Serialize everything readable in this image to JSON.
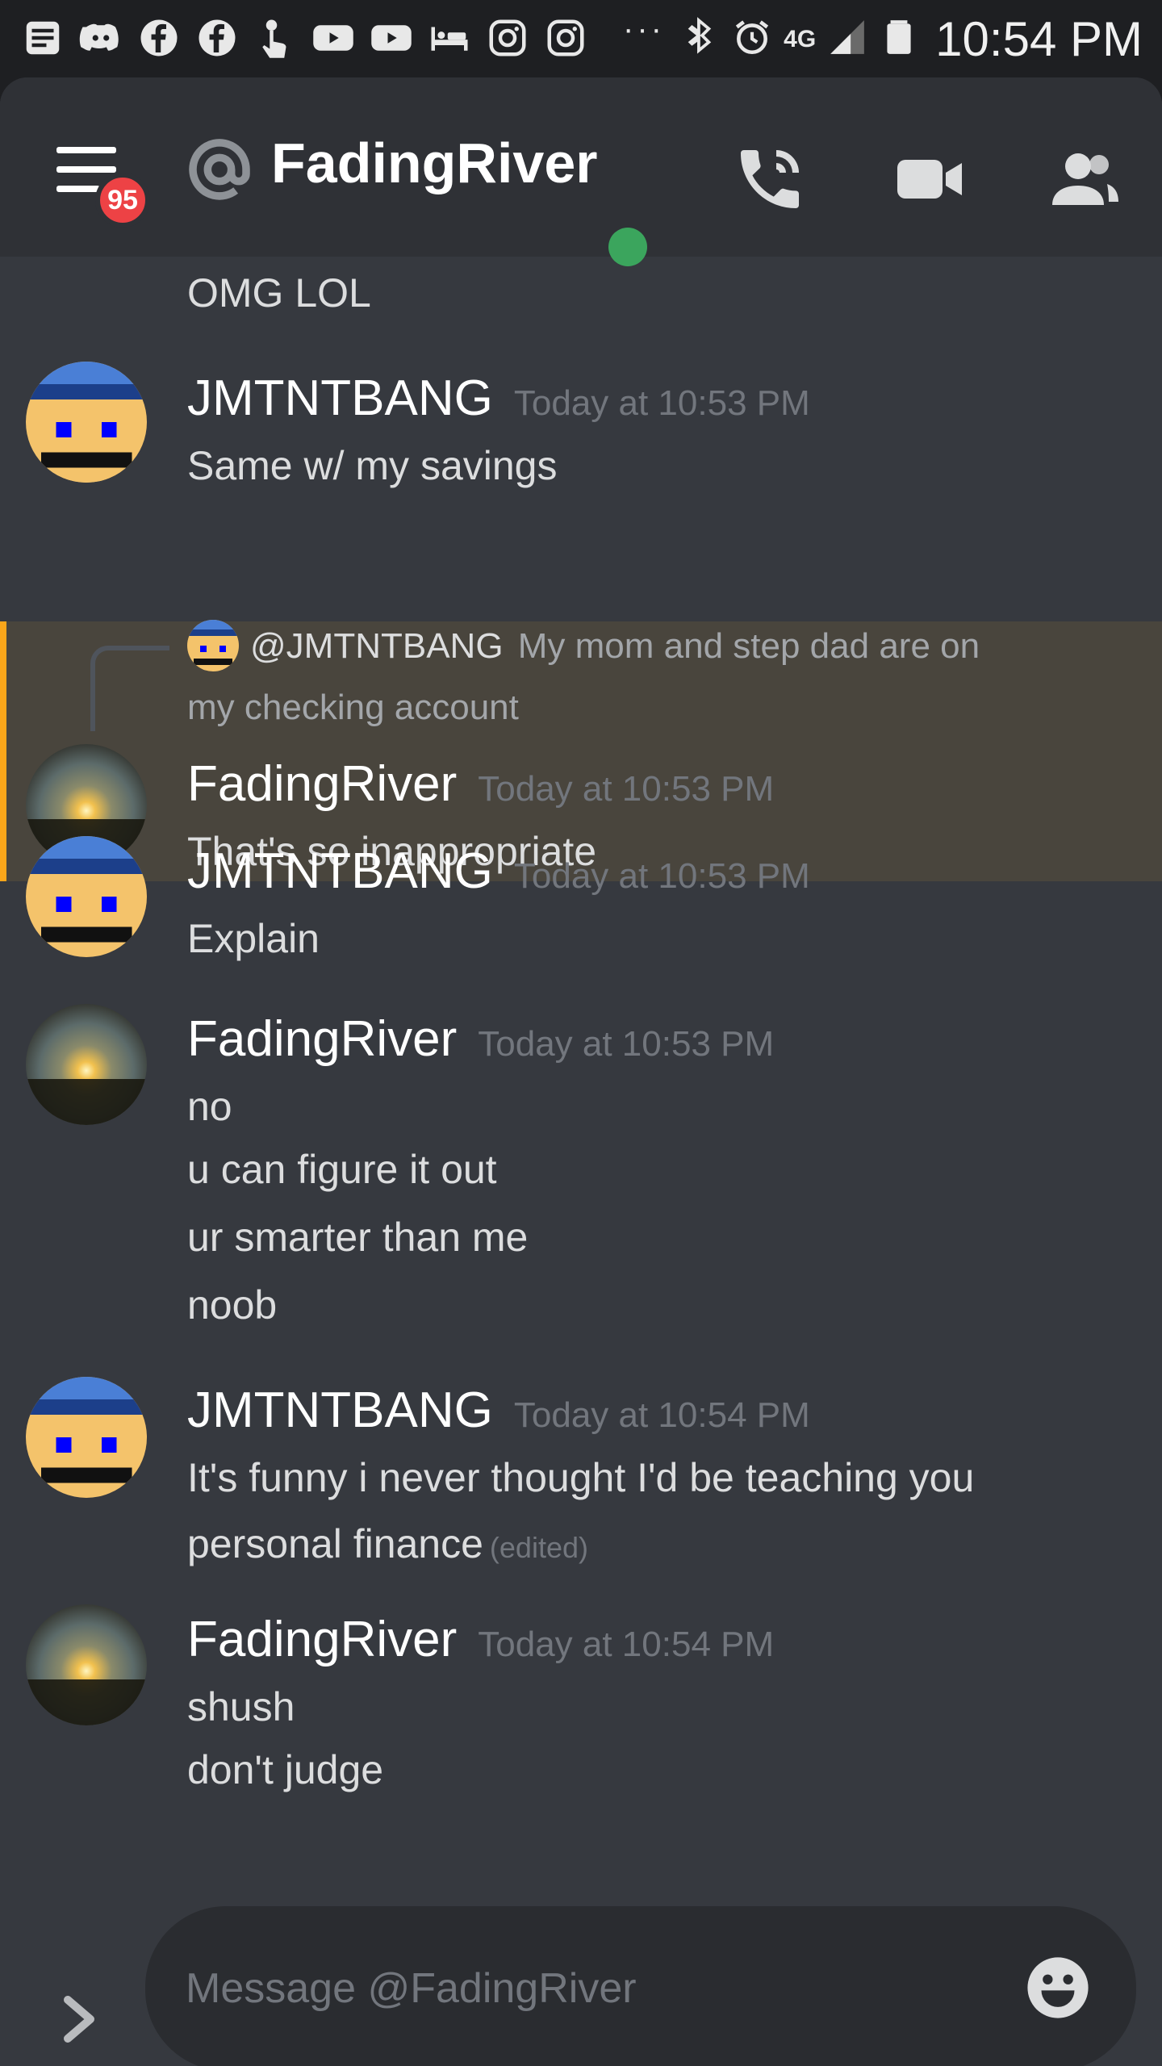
{
  "status_bar": {
    "time": "10:54 PM",
    "left_icons": [
      "notes-icon",
      "discord-icon",
      "facebook-icon",
      "facebook-icon",
      "touch-icon",
      "youtube-icon",
      "youtube-icon",
      "hotel-icon",
      "instagram-icon",
      "instagram-icon"
    ],
    "more": "···",
    "right_icons": [
      "bluetooth-icon",
      "alarm-icon",
      "lte-icon",
      "signal-icon",
      "battery-icon"
    ],
    "network_label": "4G"
  },
  "header": {
    "notification_count": "95",
    "title": "FadingRiver",
    "status": "online",
    "colors": {
      "online": "#3ba55d",
      "badge": "#ed4245"
    }
  },
  "conversation": {
    "previous_line": "OMG LOL",
    "messages": [
      {
        "author": "JMTNTBANG",
        "time": "Today at 10:53 PM",
        "lines": [
          "Same w/ my savings"
        ]
      },
      {
        "author": "FadingRiver",
        "time": "Today at 10:53 PM",
        "highlighted": true,
        "reply": {
          "mention": "@JMTNTBANG",
          "text_1": "My mom and step dad are on",
          "text_2": "my checking account"
        },
        "lines": [
          "That's so inappropriate"
        ]
      },
      {
        "author": "JMTNTBANG",
        "time": "Today at 10:53 PM",
        "lines": [
          "Explain"
        ]
      },
      {
        "author": "FadingRiver",
        "time": "Today at 10:53 PM",
        "lines": [
          "no",
          "u can figure it out",
          "ur smarter than me",
          "noob"
        ]
      },
      {
        "author": "JMTNTBANG",
        "time": "Today at 10:54 PM",
        "lines": [
          "It's funny i never thought I'd be teaching you",
          "personal finance"
        ],
        "edited_label": "(edited)"
      },
      {
        "author": "FadingRiver",
        "time": "Today at 10:54 PM",
        "lines": [
          "shush",
          "don't judge"
        ]
      }
    ]
  },
  "input": {
    "placeholder": "Message @FadingRiver",
    "value": ""
  },
  "accent": {
    "highlight_bar": "#faa61a",
    "highlight_bg": "#49453d"
  }
}
